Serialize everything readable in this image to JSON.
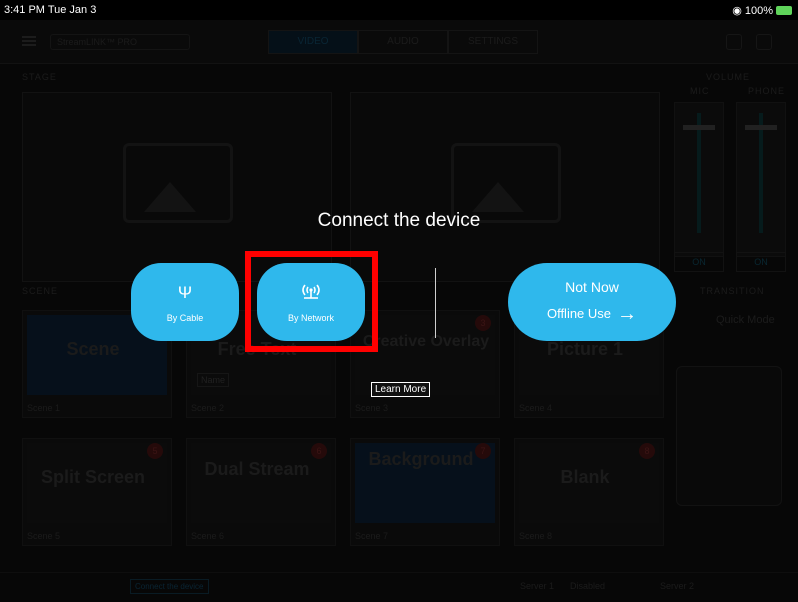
{
  "status_bar": {
    "time": "3:41 PM  Tue Jan 3",
    "battery": "100%"
  },
  "app": {
    "device_name": "StreamLINK™ PRO",
    "tabs": [
      "VIDEO",
      "AUDIO",
      "SETTINGS"
    ],
    "stage_label": "STAGE",
    "volume_label": "VOLUME",
    "mic_label": "MIC",
    "phone_label": "PHONE",
    "on_label": "ON",
    "scene_label": "SCENE",
    "transition_label": "TRANSITION",
    "quick_mode_label": "Quick Mode",
    "scenes": [
      {
        "title": "Scene",
        "foot": "Scene 1",
        "num": ""
      },
      {
        "title": "Free Text",
        "foot": "Scene 2",
        "num": ""
      },
      {
        "title": "Creative Overlay",
        "foot": "Scene 3",
        "num": "3"
      },
      {
        "title": "Picture 1",
        "foot": "Scene 4",
        "num": ""
      },
      {
        "title": "Split Screen",
        "foot": "Scene 5",
        "num": "5"
      },
      {
        "title": "Dual Stream",
        "foot": "Scene 6",
        "num": "6"
      },
      {
        "title": "Background",
        "foot": "Scene 7",
        "num": "7"
      },
      {
        "title": "Blank",
        "foot": "Scene 8",
        "num": "8"
      }
    ],
    "free_text_name": "Name",
    "connect_link": "Connect the device",
    "server1": "Server 1",
    "server1_status": "Disabled",
    "server2": "Server 2"
  },
  "dialog": {
    "title": "Connect the device",
    "by_cable": "By Cable",
    "by_network": "By Network",
    "not_now": "Not Now",
    "offline_use": "Offline Use",
    "learn_more": "Learn More",
    "cable_icon": "usb-icon",
    "network_icon": "wireless-antenna-icon"
  }
}
